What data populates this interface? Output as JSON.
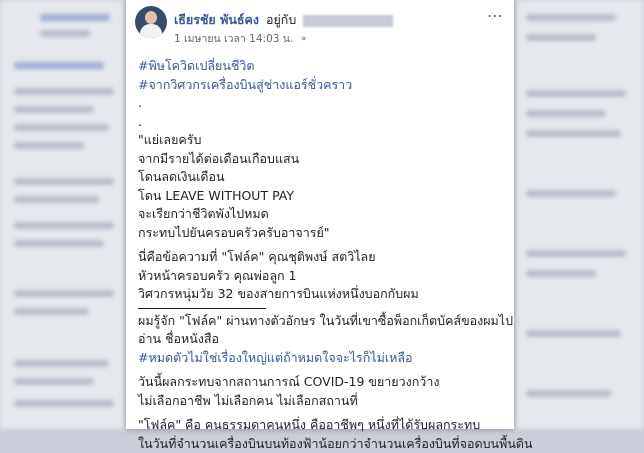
{
  "post": {
    "author": "เธียรชัย พันธ์คง",
    "with_label": "อยู่กับ",
    "timestamp": "1 เมษายน เวลา 14:03 น.",
    "hashtags": [
      "#พิษโควิดเปลี่ยนชีวิต",
      "#จากวิศวกรเครื่องบินสู่ช่างแอร์ชั่วคราว"
    ],
    "dots": [
      ".",
      "."
    ],
    "quote_lines": [
      "\"แย่เลยครับ",
      "จากมีรายได้ต่อเดือนเกือบแสน",
      "โดนลดเงินเดือน",
      "โดน LEAVE WITHOUT PAY",
      "จะเรียกว่าชีวิตพังไปหมด",
      "กระทบไปยันครอบครัวครับอาจารย์\""
    ],
    "intro_lines": [
      "นี่คือข้อความที่ \"โฟล์ค\" คุณชุติพงษ์ สตวิไลย",
      "หัวหน้าครอบครัว คุณพ่อลูก 1",
      "วิศวกรหนุ่มวัย 32 ของสายการบินแห่งหนึ่งบอกกับผม"
    ],
    "story_lines": [
      "ผมรู้จัก \"โฟล์ค\" ผ่านทางตัวอักษร ในวันที่เขาซื้อพ็อกเก็ตบัคส์ของผมไป",
      "อ่าน ชื่อหนังสือ"
    ],
    "book_tag": "#หมดตัวไม่ใช่เรื่องใหญ่แต่ถ้าหมดใจจะไรก็ไม่เหลือ",
    "closing_lines": [
      "วันนี้ผลกระทบจากสถานการณ์ COVID-19 ขยายวงกว้าง",
      "ไม่เลือกอาชีพ ไม่เลือกคน ไม่เลือกสถานที่",
      "\"โฟล์ค\" คือ คนธรรมดาคนหนึ่ง คืออาชีพๆ หนึ่งที่ได้รับผลกระทบ",
      "ในวันที่จำนวนเครื่องบินบนท้องฟ้าน้อยกว่าจำนวนเครื่องบินที่จอดบนพื้นดิน"
    ]
  },
  "icons": {
    "more": "more-options-icon",
    "privacy": "globe-icon"
  }
}
